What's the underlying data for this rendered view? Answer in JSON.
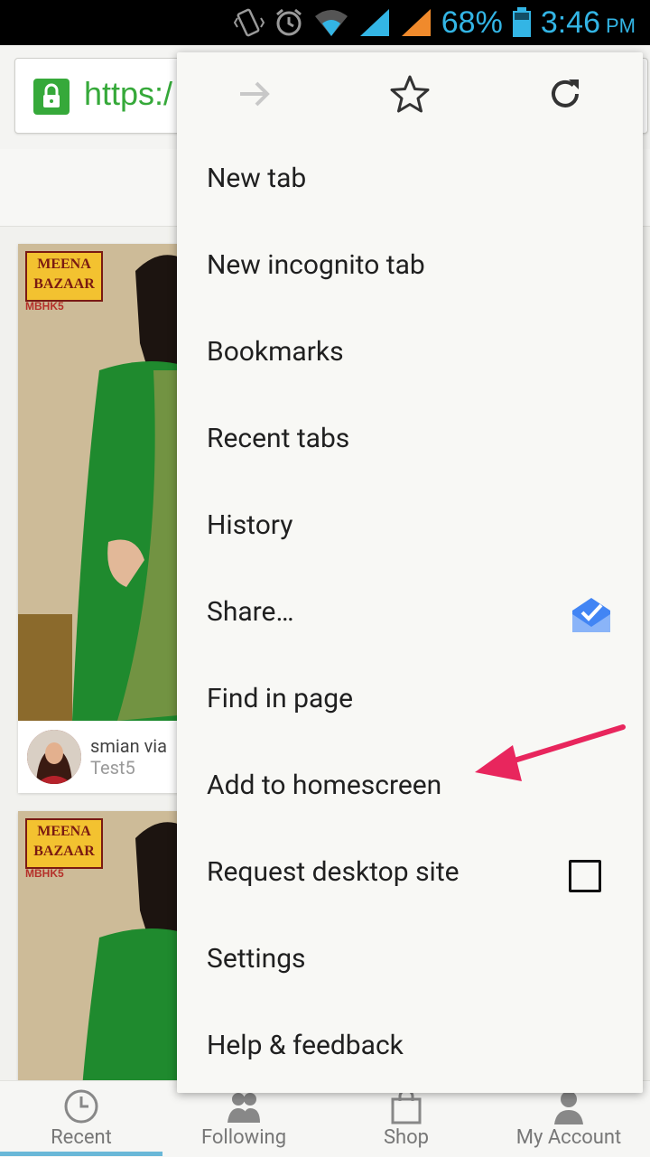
{
  "status_bar": {
    "battery": "68%",
    "time": "3:46",
    "ampm": "PM",
    "icons": [
      "vibrate-icon",
      "alarm-icon",
      "wifi-icon",
      "signal-icon",
      "signal-icon",
      "battery-icon"
    ]
  },
  "browser": {
    "url_fragment": "https:/"
  },
  "content": {
    "card": {
      "logo_line1": "MEENA",
      "logo_line2": "BAZAAR",
      "code": "MBHK5",
      "user": "smian via",
      "source": "Test5"
    }
  },
  "menu": {
    "top_icons": [
      "forward-icon",
      "star-icon",
      "reload-icon"
    ],
    "items": [
      {
        "label": "New tab"
      },
      {
        "label": "New incognito tab"
      },
      {
        "label": "Bookmarks"
      },
      {
        "label": "Recent tabs"
      },
      {
        "label": "History"
      },
      {
        "label": "Share…"
      },
      {
        "label": "Find in page"
      },
      {
        "label": "Add to homescreen"
      },
      {
        "label": "Request desktop site"
      },
      {
        "label": "Settings"
      },
      {
        "label": "Help & feedback"
      }
    ]
  },
  "bottom_nav": [
    {
      "label": "Recent"
    },
    {
      "label": "Following"
    },
    {
      "label": "Shop"
    },
    {
      "label": "My Account"
    }
  ],
  "colors": {
    "accent": "#33b5e5",
    "secure": "#36a93a",
    "arrow": "#e8265d"
  }
}
